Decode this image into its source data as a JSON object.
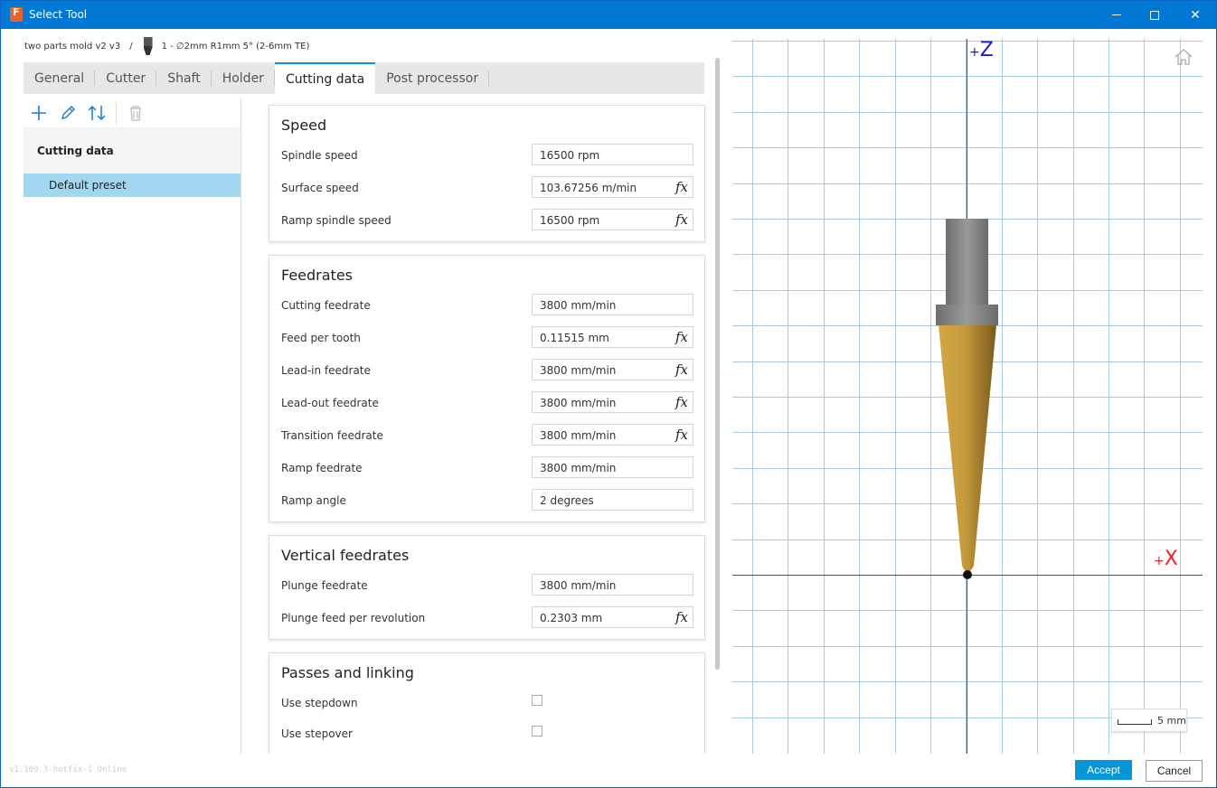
{
  "window": {
    "title": "Select Tool"
  },
  "breadcrumb": {
    "document": "two parts mold v2 v3",
    "separator": "/",
    "tool": "1 - ∅2mm R1mm 5° (2-6mm TE)"
  },
  "tabs": [
    {
      "label": "General",
      "active": false
    },
    {
      "label": "Cutter",
      "active": false
    },
    {
      "label": "Shaft",
      "active": false
    },
    {
      "label": "Holder",
      "active": false
    },
    {
      "label": "Cutting data",
      "active": true
    },
    {
      "label": "Post processor",
      "active": false
    }
  ],
  "left_panel": {
    "toolbar_icons": [
      "add-icon",
      "edit-icon",
      "sort-icon",
      "delete-icon"
    ],
    "header": "Cutting data",
    "presets": [
      "Default preset"
    ]
  },
  "sections": {
    "speed": {
      "title": "Speed",
      "rows": [
        {
          "label": "Spindle speed",
          "value": "16500 rpm",
          "fx": false
        },
        {
          "label": "Surface speed",
          "value": "103.67256 m/min",
          "fx": true
        },
        {
          "label": "Ramp spindle speed",
          "value": "16500 rpm",
          "fx": true
        }
      ]
    },
    "feedrates": {
      "title": "Feedrates",
      "rows": [
        {
          "label": "Cutting feedrate",
          "value": "3800 mm/min",
          "fx": false
        },
        {
          "label": "Feed per tooth",
          "value": "0.11515 mm",
          "fx": true
        },
        {
          "label": "Lead-in feedrate",
          "value": "3800 mm/min",
          "fx": true
        },
        {
          "label": "Lead-out feedrate",
          "value": "3800 mm/min",
          "fx": true
        },
        {
          "label": "Transition feedrate",
          "value": "3800 mm/min",
          "fx": true
        },
        {
          "label": "Ramp feedrate",
          "value": "3800 mm/min",
          "fx": false
        },
        {
          "label": "Ramp angle",
          "value": "2 degrees",
          "fx": false
        }
      ]
    },
    "vertical": {
      "title": "Vertical feedrates",
      "rows": [
        {
          "label": "Plunge feedrate",
          "value": "3800 mm/min",
          "fx": false
        },
        {
          "label": "Plunge feed per revolution",
          "value": "0.2303 mm",
          "fx": true
        }
      ]
    },
    "passes": {
      "title": "Passes and linking",
      "rows": [
        {
          "label": "Use stepdown",
          "checked": false
        },
        {
          "label": "Use stepover",
          "checked": false
        }
      ]
    }
  },
  "fx_symbol": "fx",
  "viewport": {
    "axis_z": "Z",
    "axis_x": "X",
    "axis_sign": "+",
    "scale_label": "5 mm",
    "colors": {
      "grid": "#a9cbe0",
      "z_axis": "#1a1ad0",
      "x_axis": "#e22222",
      "shaft": "#888888",
      "cutter": "#c8a040"
    }
  },
  "footer": {
    "version": "v1.109.3-hotfix-1 Online",
    "accept": "Accept",
    "cancel": "Cancel"
  }
}
